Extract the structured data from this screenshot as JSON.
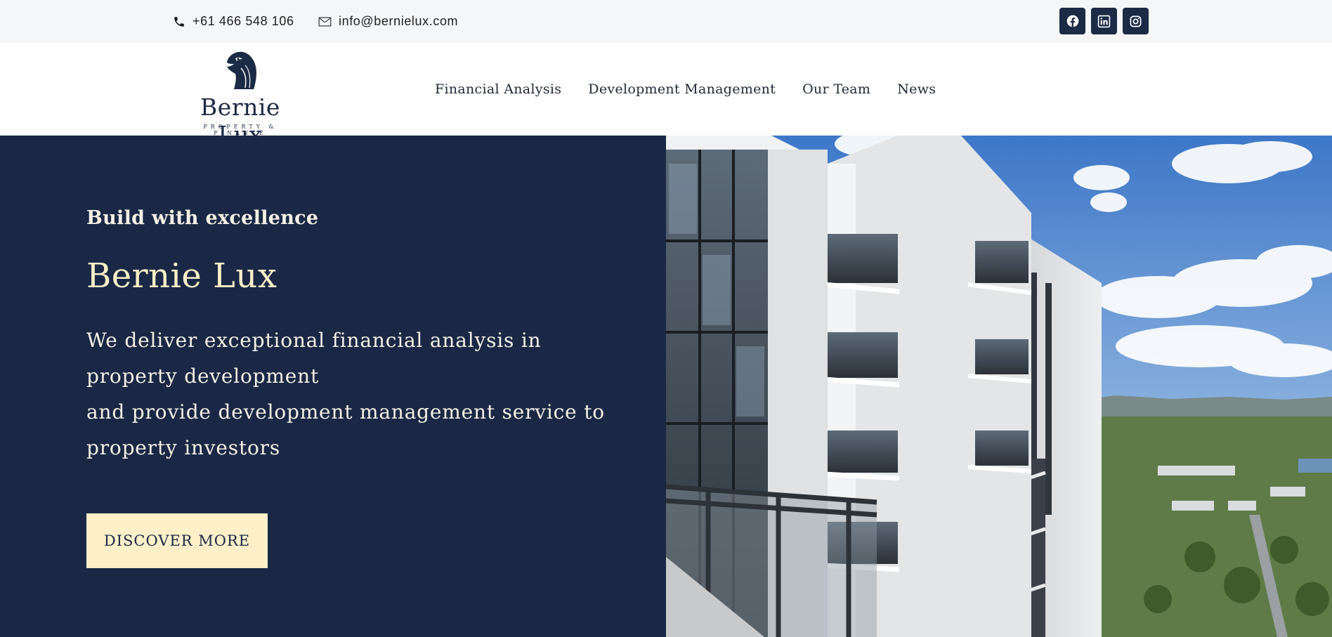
{
  "topbar": {
    "phone": "+61 466 548 106",
    "email": "info@bernielux.com",
    "icons": {
      "phone": "phone-icon",
      "email": "envelope-icon"
    },
    "socials": [
      "facebook-icon",
      "linkedin-icon",
      "instagram-icon"
    ]
  },
  "header": {
    "logo": {
      "name": "Bernie Lux",
      "tagline": "PROPERTY & FINANCE",
      "icon": "eagle-icon"
    },
    "nav": [
      "Financial Analysis",
      "Development Management",
      "Our Team",
      "News"
    ]
  },
  "hero": {
    "eyebrow": "Build with excellence",
    "title": "Bernie Lux",
    "description_line1": "We deliver exceptional financial analysis in property development",
    "description_line2": "and provide development management service to property investors",
    "cta": "DISCOVER MORE"
  },
  "colors": {
    "navy": "#1a2845",
    "cream": "#fdf0c9",
    "topbar_bg": "#f5f6f8"
  }
}
